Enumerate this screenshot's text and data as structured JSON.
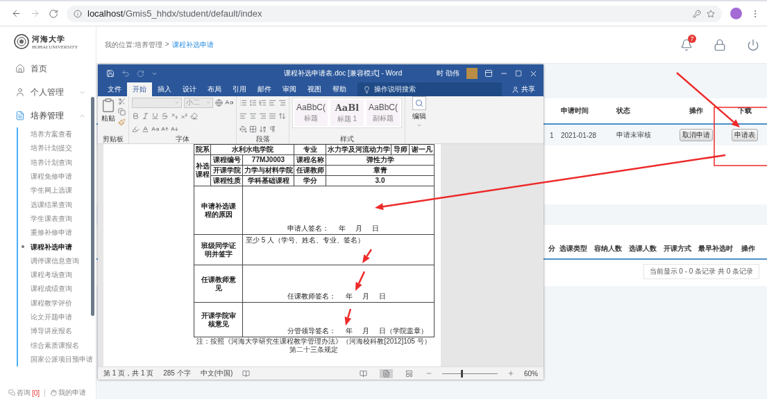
{
  "browser": {
    "url_host": "localhost",
    "url_path": "/Gmis5_hhdx/student/default/index"
  },
  "logo": {
    "name": "河海大学",
    "subtitle": "HOHAI UNIVERSITY"
  },
  "breadcrumb": {
    "label": "我的位置:培养管理",
    "separator": ">",
    "current": "课程补选申请"
  },
  "notifications": {
    "count": "7"
  },
  "sidebar": {
    "items": [
      {
        "kind": "link",
        "label": "首页",
        "selected": false
      },
      {
        "kind": "group",
        "label": "个人管理",
        "selected": false,
        "expanded": false
      },
      {
        "kind": "group",
        "label": "培养管理",
        "selected": true,
        "expanded": true,
        "children": [
          {
            "label": "培养方案查看",
            "selected": false
          },
          {
            "label": "培养计划提交",
            "selected": false
          },
          {
            "label": "培养计划查询",
            "selected": false
          },
          {
            "label": "课程免修申请",
            "selected": false
          },
          {
            "label": "学生网上选课",
            "selected": false
          },
          {
            "label": "选课结果查询",
            "selected": false
          },
          {
            "label": "学生课表查询",
            "selected": false
          },
          {
            "label": "重修补修申请",
            "selected": false
          },
          {
            "label": "课程补选申请",
            "selected": true
          },
          {
            "label": "调停课信息查询",
            "selected": false
          },
          {
            "label": "课程考场查询",
            "selected": false
          },
          {
            "label": "课程成绩查询",
            "selected": false
          },
          {
            "label": "课程教学评价",
            "selected": false
          },
          {
            "label": "论文开题申请",
            "selected": false
          },
          {
            "label": "博导讲座报名",
            "selected": false
          },
          {
            "label": "综合素质课报名",
            "selected": false
          },
          {
            "label": "国家公派项目预申请",
            "selected": false
          }
        ]
      }
    ],
    "footer": {
      "consult": "咨询",
      "consult_count": "[0]",
      "my_requests": "我的申请"
    }
  },
  "applications": {
    "columns": [
      "申请时间",
      "状态",
      "操作",
      "下载"
    ],
    "rows": [
      {
        "cut_cell": "1",
        "date": "2021-01-28",
        "status": "申请未审核",
        "action": "取消申请",
        "download": "申请表"
      }
    ]
  },
  "courses": {
    "columns": [
      "分",
      "选课类型",
      "容纳人数",
      "选课人数",
      "开课方式",
      "最早补选时",
      "操作"
    ],
    "pager": "当前显示 0 - 0 条记录 共 0 条记录"
  },
  "word": {
    "title": "课程补选申请表.doc [兼容模式]  -  Word",
    "user": "时 劭伟",
    "tabs": [
      {
        "label": "文件",
        "selected": false
      },
      {
        "label": "开始",
        "selected": true
      },
      {
        "label": "插入",
        "selected": false
      },
      {
        "label": "设计",
        "selected": false
      },
      {
        "label": "布局",
        "selected": false
      },
      {
        "label": "引用",
        "selected": false
      },
      {
        "label": "邮件",
        "selected": false
      },
      {
        "label": "审阅",
        "selected": false
      },
      {
        "label": "视图",
        "selected": false
      },
      {
        "label": "帮助",
        "selected": false
      }
    ],
    "search_placeholder": "操作说明搜索",
    "share": "共享",
    "ribbon": {
      "paste": "粘贴",
      "font_size": "小二",
      "groups": [
        "剪贴板",
        "字体",
        "段落",
        "样式"
      ],
      "editing": "编辑",
      "styles": [
        {
          "preview": "AaBbC(",
          "label": "标题"
        },
        {
          "preview": "AaBl",
          "label": "标题 1"
        },
        {
          "preview": "AaBbC(",
          "label": "副标题"
        }
      ]
    },
    "document": {
      "info": [
        {
          "label": "院系",
          "value": "水利水电学院"
        },
        {
          "label": "专业",
          "value": "水力学及河流动力学"
        },
        {
          "label": "导师",
          "value": "谢一凡"
        }
      ],
      "course_label": "补选课程",
      "course_rows": [
        [
          {
            "label": "课程编号",
            "value": "77MJ0003"
          },
          {
            "label": "课程名称",
            "value": "弹性力学"
          }
        ],
        [
          {
            "label": "开课学院",
            "value": "力学与材料学院"
          },
          {
            "label": "任课教师",
            "value": "章青"
          }
        ],
        [
          {
            "label": "课程性质",
            "value": "学科基础课程"
          },
          {
            "label": "学分",
            "value": "3.0"
          }
        ]
      ],
      "sections": [
        {
          "label": "申请补选课程的原因",
          "signature": {
            "label": "申请人签名：",
            "year": "年",
            "month": "月",
            "day": "日"
          }
        },
        {
          "label": "班级同学证明并签字",
          "text": "至少 5 人（学号、姓名、专业、签名）"
        },
        {
          "label": "任课教师意见",
          "signature": {
            "label": "任课教师签名：",
            "year": "年",
            "month": "月",
            "day": "日"
          }
        },
        {
          "label": "开课学院审核意见",
          "signature": {
            "label": "分管领导签名：",
            "year": "年",
            "month": "月",
            "day": "日（学院盖章）"
          }
        }
      ],
      "note": "注：按照《河海大学研究生课程教学管理办法》（河海校科教[2012]105 号）第二十三条规定"
    },
    "status": {
      "page": "第 1 页，共 1 页",
      "words": "285 个字",
      "language": "中文(中国)",
      "zoom": "60%",
      "zoom_slider": {
        "level": 0.35
      }
    }
  }
}
